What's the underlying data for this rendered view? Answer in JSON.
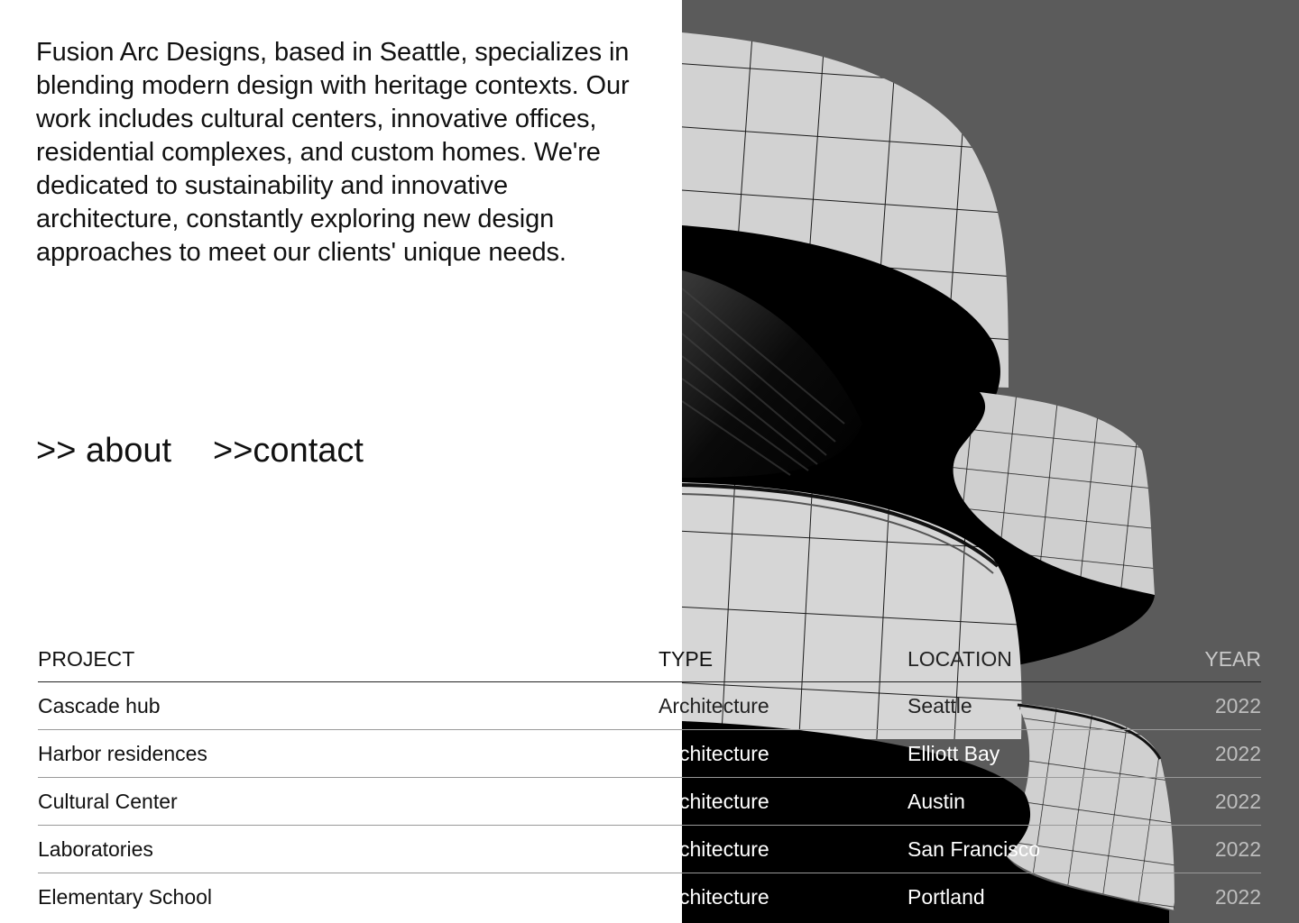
{
  "intro": {
    "text": "Fusion Arc Designs, based in Seattle, specializes in blending modern design with heritage contexts. Our work includes cultural centers, innovative offices, residential complexes, and custom homes. We're dedicated to sustainability and innovative architecture, constantly exploring new design approaches to meet our clients' unique needs."
  },
  "nav": {
    "about_label": ">> about",
    "contact_label": ">>contact"
  },
  "table": {
    "headers": {
      "project": "PROJECT",
      "type": "TYPE",
      "location": "LOCATION",
      "year": "YEAR"
    },
    "rows": [
      {
        "project": "Cascade hub",
        "type": "Architecture",
        "location": "Seattle",
        "year": "2022"
      },
      {
        "project": "Harbor residences",
        "type": "Architecture",
        "location": "Elliott Bay",
        "year": "2022"
      },
      {
        "project": "Cultural Center",
        "type": "Architecture",
        "location": "Austin",
        "year": "2022"
      },
      {
        "project": "Laboratories",
        "type": "Architecture",
        "location": "San Francisco",
        "year": "2022"
      },
      {
        "project": "Elementary School",
        "type": "Architecture",
        "location": "Portland",
        "year": "2022"
      }
    ]
  },
  "colors": {
    "photo_background": "#5b5b5b",
    "building_panels": "#d4d4d4",
    "building_shadow": "#000000",
    "text": "#111111"
  }
}
